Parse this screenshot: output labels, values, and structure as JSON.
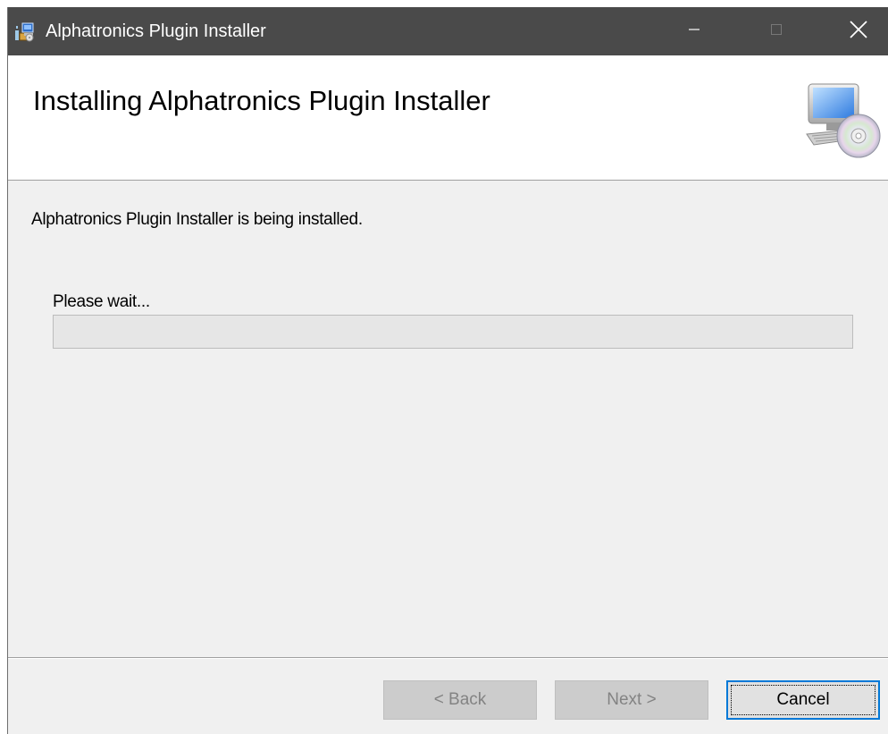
{
  "window": {
    "title": "Alphatronics Plugin Installer",
    "icon": "installer-package-icon",
    "controls": {
      "minimize": "minimize-icon",
      "maximize": "maximize-icon",
      "close": "close-icon"
    }
  },
  "header": {
    "title": "Installing Alphatronics Plugin Installer",
    "icon": "computer-disc-icon"
  },
  "main": {
    "status_text": "Alphatronics Plugin Installer is being installed.",
    "progress_label": "Please wait...",
    "progress_value": 0
  },
  "buttons": {
    "back_label": "< Back",
    "next_label": "Next >",
    "cancel_label": "Cancel"
  },
  "colors": {
    "titlebar": "#4a4a4a",
    "focus_accent": "#0078d7",
    "progress_fill": "#06b025"
  }
}
